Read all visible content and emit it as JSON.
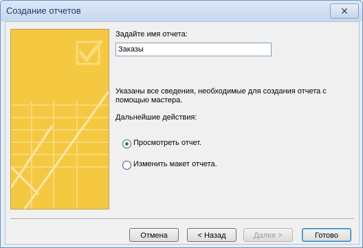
{
  "window": {
    "title": "Создание отчетов",
    "close_label": "✕"
  },
  "form": {
    "name_label": "Задайте имя отчета:",
    "name_value": "Заказы",
    "info_text": "Указаны все сведения, необходимые для создания отчета с помощью мастера.",
    "next_actions_label": "Дальнейшие действия:",
    "options": [
      {
        "label": "Просмотреть отчет.",
        "selected": true
      },
      {
        "label": "Изменить макет отчета.",
        "selected": false
      }
    ]
  },
  "buttons": {
    "cancel": "Отмена",
    "back": "< Назад",
    "next": "Далее >",
    "finish": "Готово"
  },
  "colors": {
    "art_background": "#f5c842",
    "radio_selected": "#2a8a2a"
  }
}
